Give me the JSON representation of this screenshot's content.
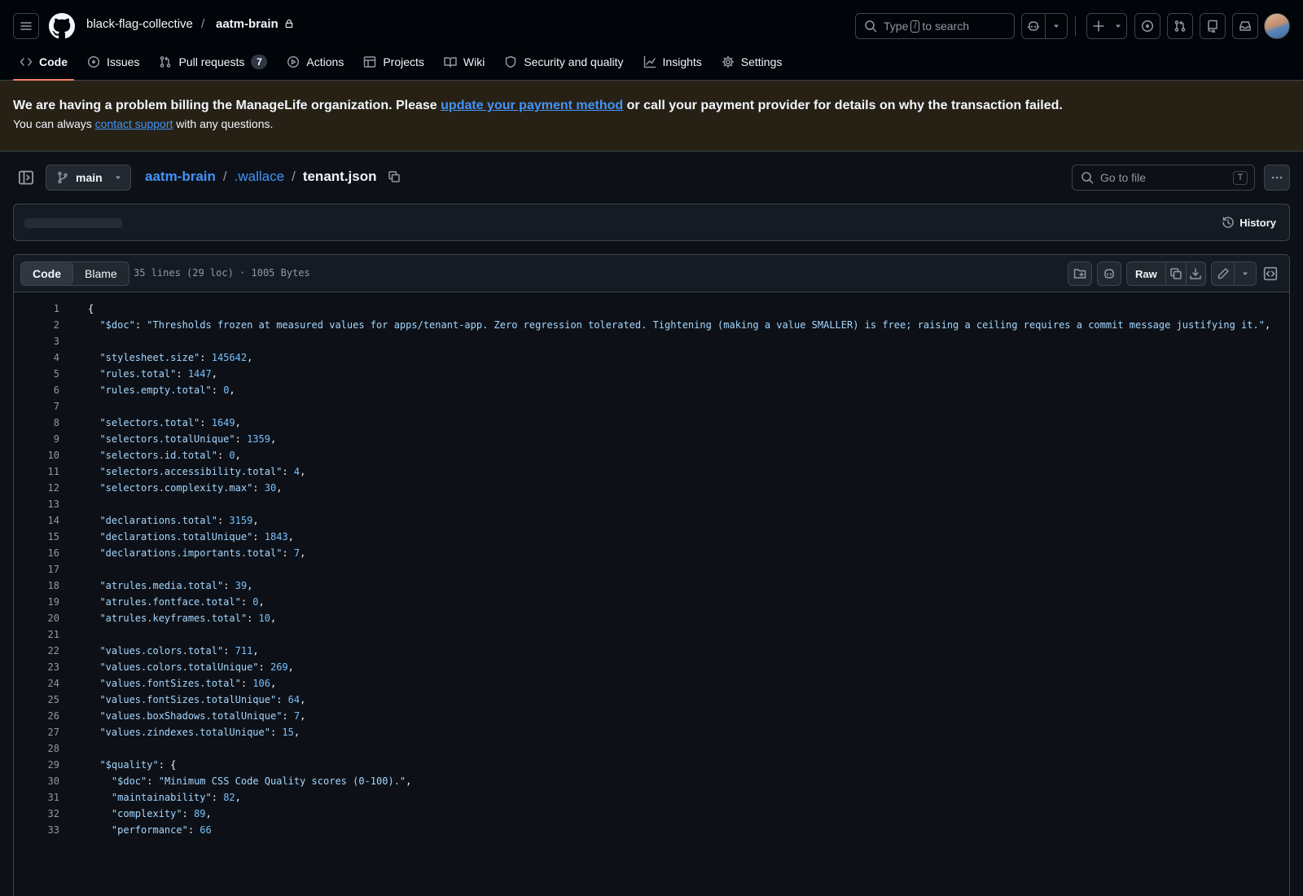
{
  "header": {
    "owner": "black-flag-collective",
    "separator": "/",
    "repo": "aatm-brain",
    "search_prefix": "Type",
    "search_key": "/",
    "search_suffix": "to search"
  },
  "nav": {
    "tabs": [
      {
        "label": "Code",
        "icon": "code-icon"
      },
      {
        "label": "Issues",
        "icon": "issue-opened-icon"
      },
      {
        "label": "Pull requests",
        "icon": "git-pull-request-icon",
        "count": "7"
      },
      {
        "label": "Actions",
        "icon": "play-icon"
      },
      {
        "label": "Projects",
        "icon": "table-icon"
      },
      {
        "label": "Wiki",
        "icon": "book-icon"
      },
      {
        "label": "Security and quality",
        "icon": "shield-icon"
      },
      {
        "label": "Insights",
        "icon": "graph-icon"
      },
      {
        "label": "Settings",
        "icon": "gear-icon"
      }
    ],
    "active": "Code"
  },
  "banner": {
    "text_before": "We are having a problem billing the ManageLife organization. Please ",
    "link_payment": "update your payment method",
    "text_after": " or call your payment provider for details on why the transaction failed.",
    "line2_before": "You can always ",
    "link_support": "contact support",
    "line2_after": " with any questions.",
    "bg_color": "#272115"
  },
  "file": {
    "branch": "main",
    "breadcrumbs": [
      "aatm-brain",
      ".wallace"
    ],
    "filename": "tenant.json",
    "goto_placeholder": "Go to file",
    "goto_key": "T",
    "history_label": "History",
    "view_tabs": [
      "Code",
      "Blame"
    ],
    "info": "35 lines (29 loc) · 1005 Bytes",
    "raw_label": "Raw"
  },
  "code_lines": [
    "{",
    "  \"$doc\": \"Thresholds frozen at measured values for apps/tenant-app. Zero regression tolerated. Tightening (making a value SMALLER) is free; raising a ceiling requires a commit message justifying it.\",",
    "",
    "  \"stylesheet.size\": 145642,",
    "  \"rules.total\": 1447,",
    "  \"rules.empty.total\": 0,",
    "",
    "  \"selectors.total\": 1649,",
    "  \"selectors.totalUnique\": 1359,",
    "  \"selectors.id.total\": 0,",
    "  \"selectors.accessibility.total\": 4,",
    "  \"selectors.complexity.max\": 30,",
    "",
    "  \"declarations.total\": 3159,",
    "  \"declarations.totalUnique\": 1843,",
    "  \"declarations.importants.total\": 7,",
    "",
    "  \"atrules.media.total\": 39,",
    "  \"atrules.fontface.total\": 0,",
    "  \"atrules.keyframes.total\": 10,",
    "",
    "  \"values.colors.total\": 711,",
    "  \"values.colors.totalUnique\": 269,",
    "  \"values.fontSizes.total\": 106,",
    "  \"values.fontSizes.totalUnique\": 64,",
    "  \"values.boxShadows.totalUnique\": 7,",
    "  \"values.zindexes.totalUnique\": 15,",
    "",
    "  \"$quality\": {",
    "    \"$doc\": \"Minimum CSS Code Quality scores (0-100).\",",
    "    \"maintainability\": 82,",
    "    \"complexity\": 89,",
    "    \"performance\": 66"
  ]
}
